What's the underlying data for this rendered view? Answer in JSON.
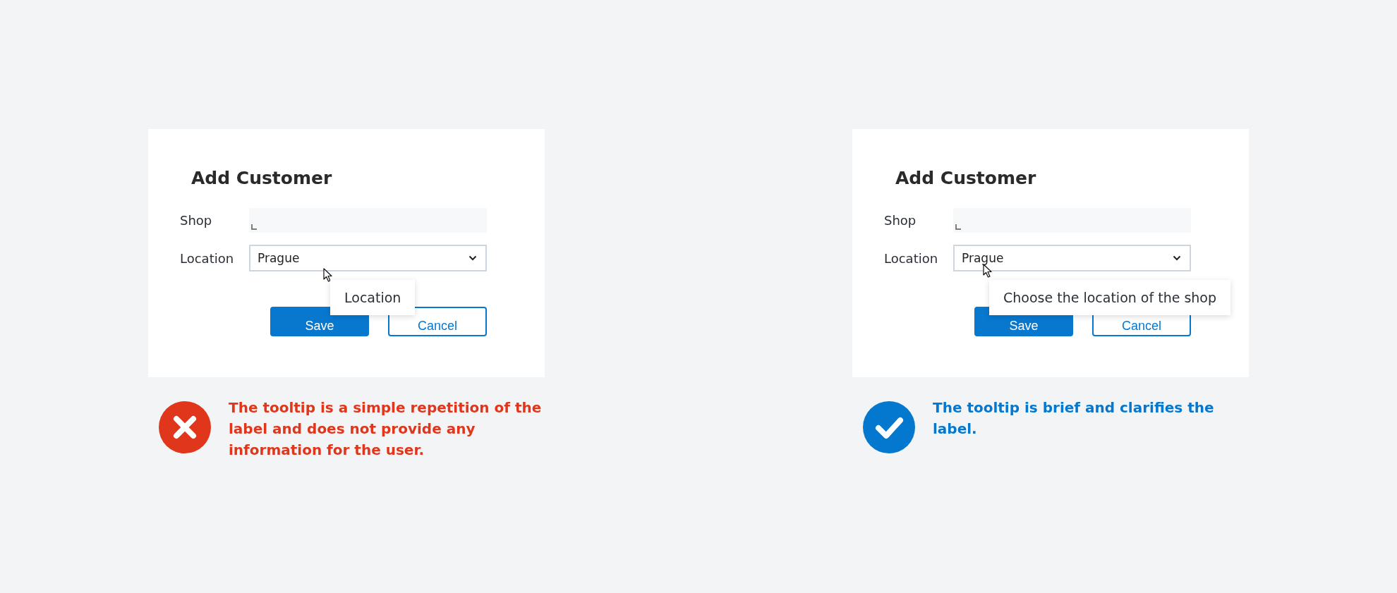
{
  "examples": [
    {
      "kind": "bad",
      "dialog": {
        "title": "Add Customer",
        "fields": [
          {
            "kind": "text",
            "label": "Shop"
          },
          {
            "kind": "select",
            "label": "Location",
            "value": "Prague"
          }
        ],
        "buttons": [
          {
            "kind": "primary",
            "label": "Save"
          },
          {
            "kind": "secondary",
            "label": "Cancel"
          }
        ],
        "tooltip": "Location"
      },
      "verdict": "The tooltip is a simple repetition of the label and does not provide any information for the user."
    },
    {
      "kind": "good",
      "dialog": {
        "title": "Add Customer",
        "fields": [
          {
            "kind": "text",
            "label": "Shop"
          },
          {
            "kind": "select",
            "label": "Location",
            "value": "Prague"
          }
        ],
        "buttons": [
          {
            "kind": "primary",
            "label": "Save"
          },
          {
            "kind": "secondary",
            "label": "Cancel"
          }
        ],
        "tooltip": "Choose the location of the shop"
      },
      "verdict": "The tooltip is brief and clarifies the label."
    }
  ]
}
